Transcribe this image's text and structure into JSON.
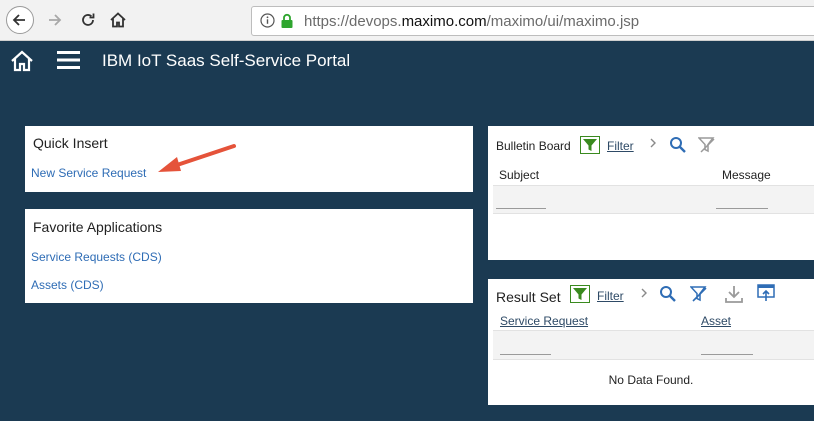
{
  "browser": {
    "url_prefix": "https://devops.",
    "url_domain": "maximo.com",
    "url_path": "/maximo/ui/maximo.jsp"
  },
  "app": {
    "title": "IBM IoT Saas Self-Service Portal"
  },
  "quick_insert": {
    "title": "Quick Insert",
    "link": "New Service Request"
  },
  "favorites": {
    "title": "Favorite Applications",
    "links": [
      "Service Requests (CDS)",
      "Assets (CDS)"
    ]
  },
  "bulletin": {
    "title": "Bulletin Board",
    "filter_label": "Filter",
    "columns": [
      "Subject",
      "Message"
    ]
  },
  "result_set": {
    "title": "Result Set",
    "filter_label": "Filter",
    "columns": [
      "Service Request",
      "Asset"
    ],
    "empty_message": "No Data Found."
  },
  "colors": {
    "background": "#1b3a52",
    "link": "#2e6cb5",
    "filter_icon_green": "#3a8a1f",
    "icon_blue": "#2f6db5",
    "arrow_red": "#e5533a"
  }
}
